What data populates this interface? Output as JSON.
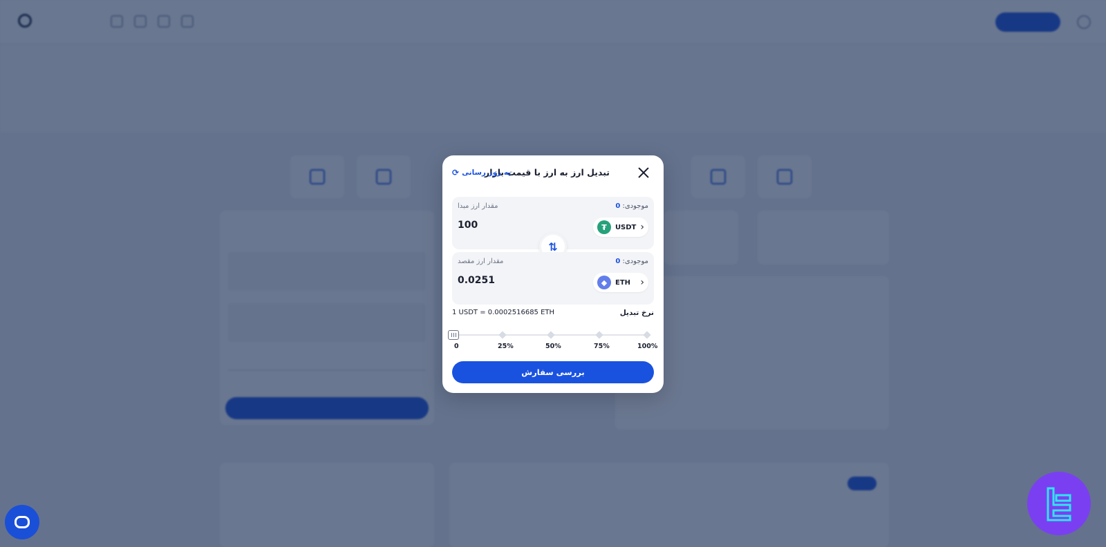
{
  "modal": {
    "title": "تبدیل ارز به ارز با قیمت بازار",
    "refresh_label": "به روز رسانی",
    "source": {
      "balance_label": "موجودی:",
      "balance_value": "0",
      "amount_label": "مقدار ارز مبدا",
      "amount": "100",
      "coin": "USDT",
      "coin_icon": "tether-icon"
    },
    "destination": {
      "balance_label": "موجودی:",
      "balance_value": "0",
      "amount_label": "مقدار ارز مقصد",
      "amount": "0.0251",
      "coin": "ETH",
      "coin_icon": "ethereum-icon"
    },
    "rate_label": "نرخ تبدیل",
    "rate_value": "1 USDT = 0.0002516685 ETH",
    "slider": {
      "labels": [
        "0",
        "25%",
        "50%",
        "75%",
        "100%"
      ],
      "value_percent": 0
    },
    "submit_label": "بررسی سفارش"
  },
  "colors": {
    "primary": "#1a52e0",
    "overlay": "#162a52",
    "usdt": "#26a17b",
    "eth": "#627eea",
    "badge": "#7b3ff2"
  }
}
